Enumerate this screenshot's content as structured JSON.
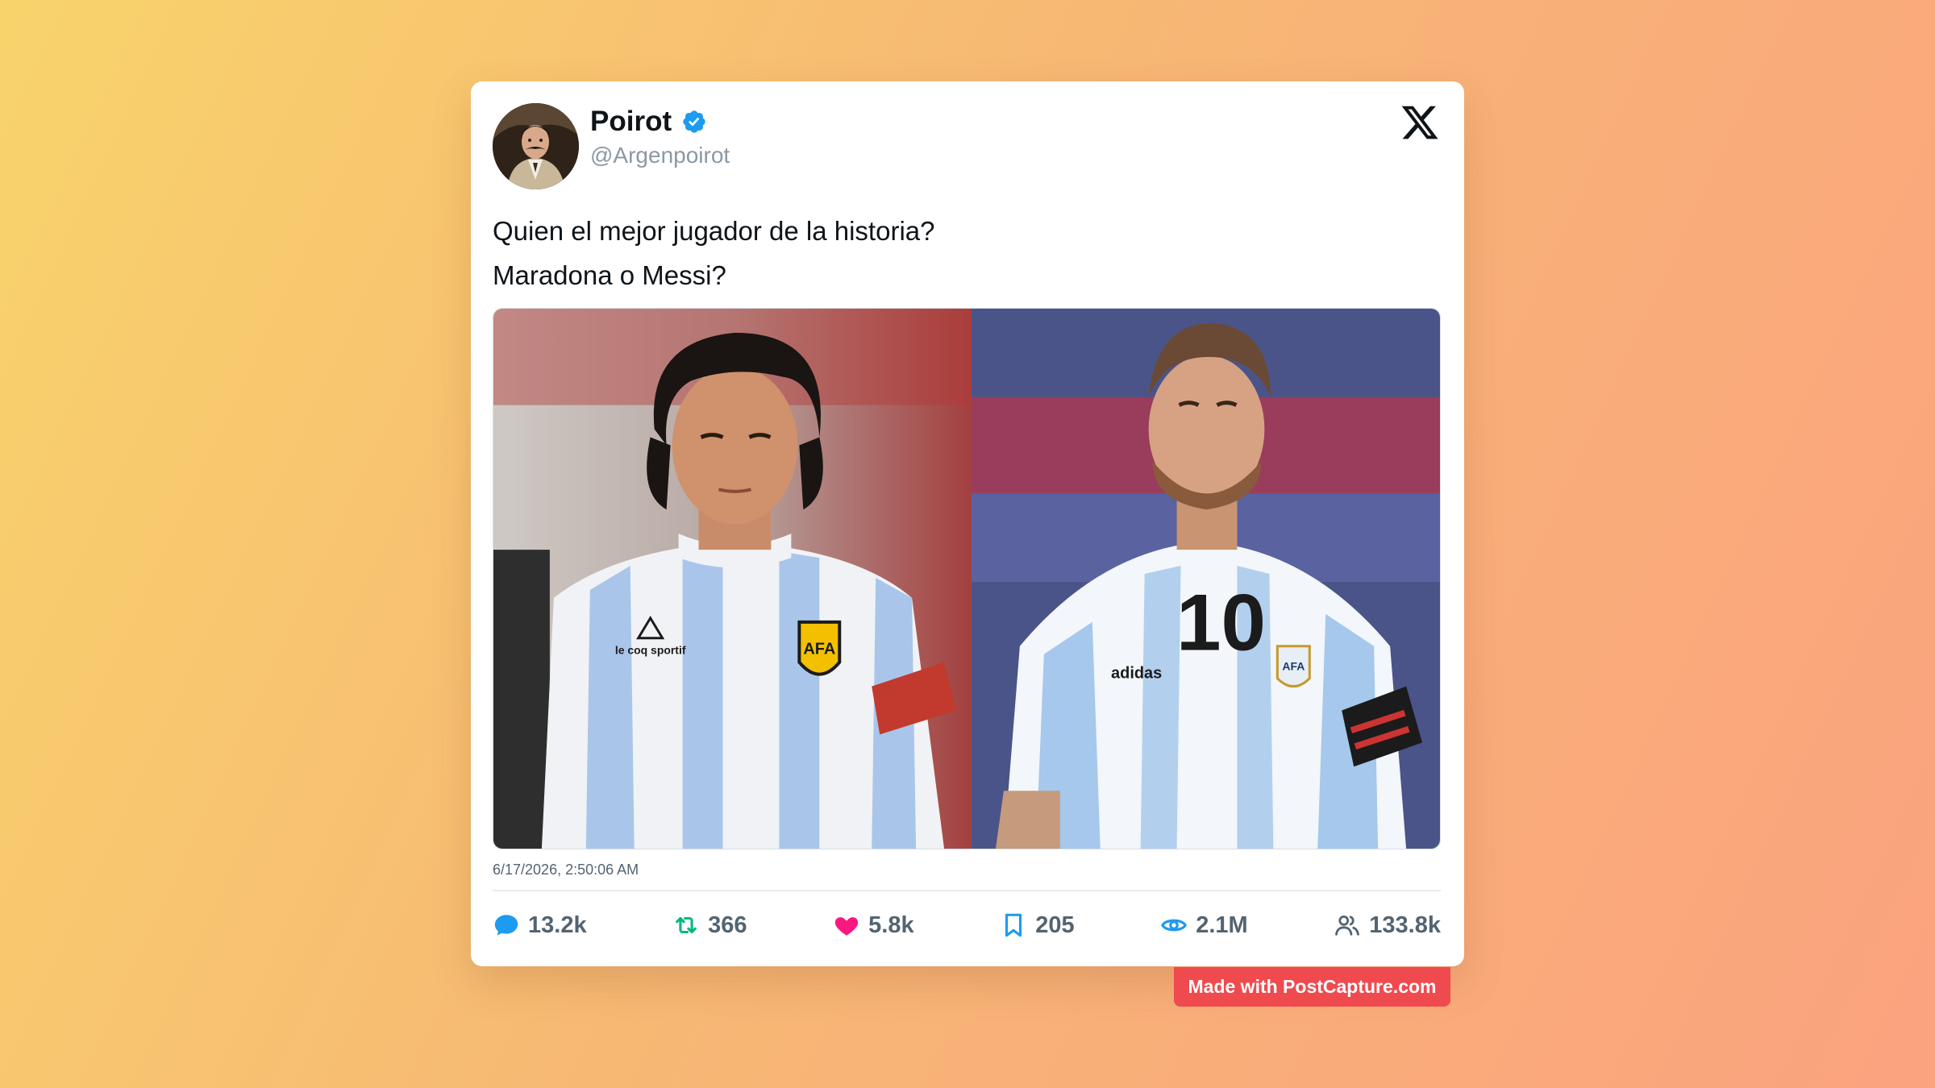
{
  "tweet": {
    "author_name": "Poirot",
    "author_handle": "@Argenpoirot",
    "text_line_1": "Quien el mejor jugador de la historia?",
    "text_line_2": "Maradona o Messi?",
    "timestamp": "6/17/2026, 2:50:06 AM",
    "verified": true
  },
  "media": {
    "left_jersey_brand": "le coq sportif",
    "left_crest": "AFA",
    "right_jersey_brand": "adidas",
    "right_crest": "AFA",
    "right_number": "10"
  },
  "stats": [
    {
      "name": "replies",
      "icon": "comment-icon",
      "value": "13.2k",
      "color": "#1d9bf0"
    },
    {
      "name": "retweets",
      "icon": "retweet-icon",
      "value": "366",
      "color": "#00ba7c"
    },
    {
      "name": "likes",
      "icon": "heart-icon",
      "value": "5.8k",
      "color": "#f91880"
    },
    {
      "name": "bookmarks",
      "icon": "bookmark-icon",
      "value": "205",
      "color": "#1d9bf0"
    },
    {
      "name": "views",
      "icon": "eye-icon",
      "value": "2.1M",
      "color": "#1d9bf0"
    },
    {
      "name": "followers",
      "icon": "users-icon",
      "value": "133.8k",
      "color": "#536471"
    }
  ],
  "watermark": "Made with PostCapture.com",
  "colors": {
    "verified_blue": "#1d9bf0",
    "badge_red": "#ef4b4f"
  }
}
